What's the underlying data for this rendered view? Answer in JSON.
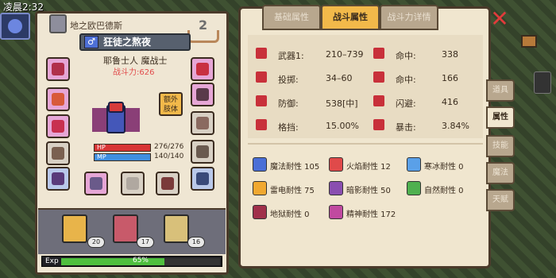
{
  "clock": "凌晨2:32",
  "character": {
    "name": "地之欧巴德斯",
    "level": "2",
    "class_title": "狂徒之熬夜",
    "gender_icon": "♂",
    "job": "耶鲁士人 魔战士",
    "power": "战斗力:626",
    "extra_button": "额外肢体",
    "hp": {
      "label": "HP",
      "value": "276/276",
      "fraction": 1.0
    },
    "mp": {
      "label": "MP",
      "value": "140/140",
      "fraction": 1.0
    }
  },
  "party": [
    {
      "badge": "20"
    },
    {
      "badge": "17"
    },
    {
      "badge": "16"
    }
  ],
  "exp": {
    "label": "Exp",
    "percent": "65%",
    "fraction": 0.65
  },
  "tabs": [
    "基础属性",
    "战斗属性",
    "战斗力详情"
  ],
  "active_tab": 1,
  "stats": [
    {
      "label": "武器1:",
      "value": "210–739",
      "icon": "sword-icon"
    },
    {
      "label": "投掷:",
      "value": "34–60",
      "icon": "bow-icon"
    },
    {
      "label": "防御:",
      "value": "538[中]",
      "icon": "shield-icon"
    },
    {
      "label": "格挡:",
      "value": "15.00%",
      "icon": "block-icon"
    },
    {
      "label": "命中:",
      "value": "338",
      "icon": "target-icon"
    },
    {
      "label": "命中:",
      "value": "166",
      "icon": "target-icon"
    },
    {
      "label": "闪避:",
      "value": "416",
      "icon": "dodge-icon"
    },
    {
      "label": "暴击:",
      "value": "3.84%",
      "icon": "crit-icon"
    }
  ],
  "resistances": [
    {
      "label": "魔法耐性 105",
      "color": "#4a6fd6",
      "icon": "star-icon"
    },
    {
      "label": "火焰耐性 12",
      "color": "#e04a4a",
      "icon": "fire-icon"
    },
    {
      "label": "寒冰耐性 0",
      "color": "#5aa0e8",
      "icon": "snowflake-icon"
    },
    {
      "label": "雷电耐性 75",
      "color": "#f0a830",
      "icon": "lightning-icon"
    },
    {
      "label": "暗影耐性 50",
      "color": "#8a4fb0",
      "icon": "shadow-icon"
    },
    {
      "label": "自然耐性 0",
      "color": "#4fb04f",
      "icon": "leaf-icon"
    },
    {
      "label": "地狱耐性 0",
      "color": "#a0304a",
      "icon": "hell-icon"
    },
    {
      "label": "精神耐性 172",
      "color": "#c04aa0",
      "icon": "spirit-icon"
    }
  ],
  "side_nav": [
    "道具",
    "属性",
    "技能",
    "魔法",
    "天赋"
  ],
  "side_nav_active": 1,
  "close_label": "✕"
}
